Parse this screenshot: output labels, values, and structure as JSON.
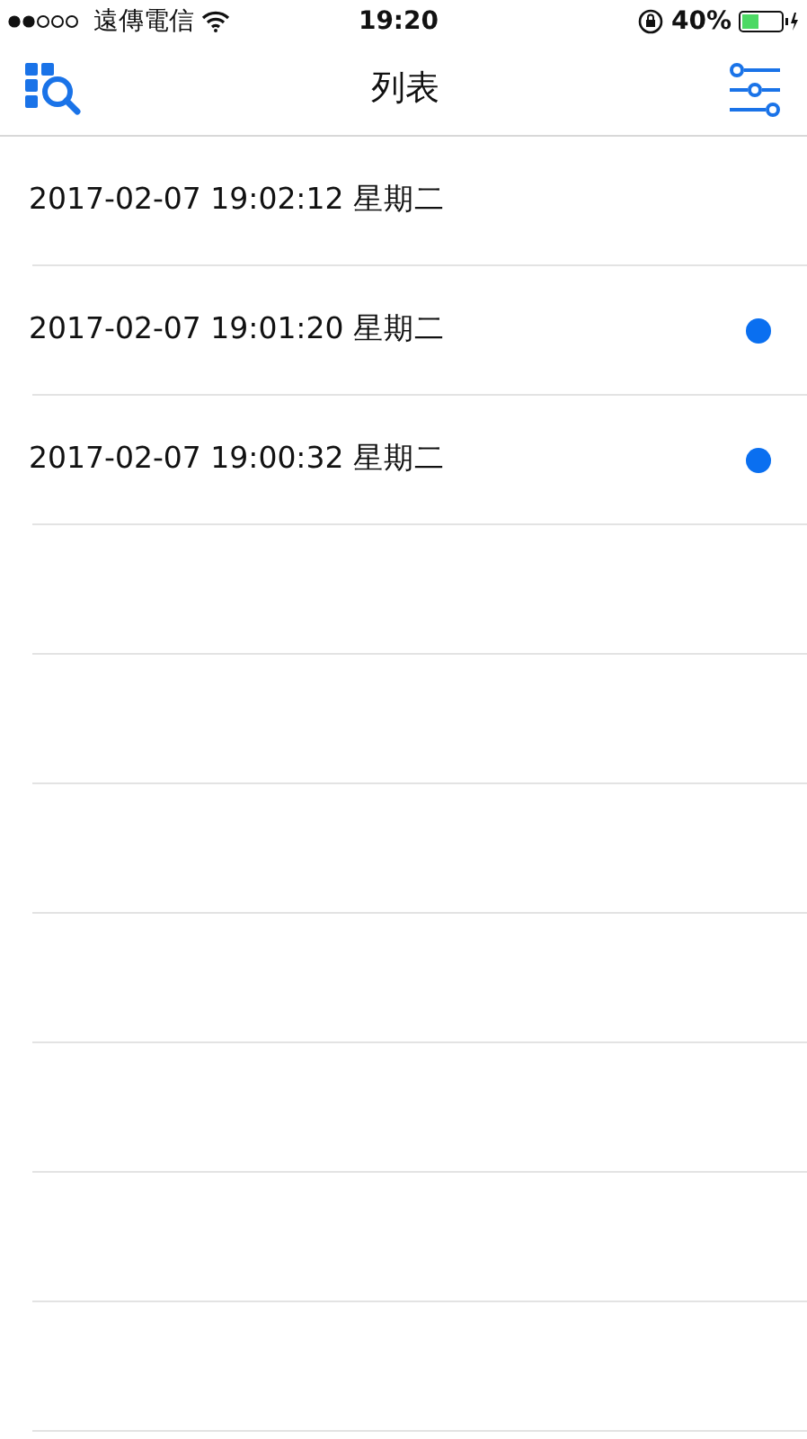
{
  "status_bar": {
    "carrier": "遠傳電信",
    "time": "19:20",
    "battery": "40%"
  },
  "nav": {
    "title": "列表"
  },
  "rows": [
    {
      "text": "2017-02-07 19:02:12 星期二",
      "unread": false
    },
    {
      "text": "2017-02-07 19:01:20 星期二",
      "unread": true
    },
    {
      "text": "2017-02-07 19:00:32 星期二",
      "unread": true
    }
  ]
}
